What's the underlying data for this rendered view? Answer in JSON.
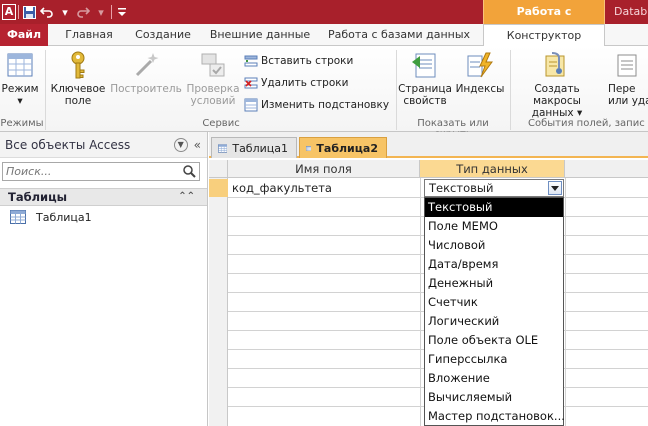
{
  "titlebar": {
    "app_icon_letter": "A",
    "context_tab_header": "Работа с таблицами",
    "title_text": "Datab"
  },
  "tabs": {
    "file": "Файл",
    "home": "Главная",
    "create": "Создание",
    "external": "Внешние данные",
    "dbtools": "Работа с базами данных",
    "design": "Конструктор"
  },
  "ribbon": {
    "view": {
      "label1": "Режим",
      "label2": "▾"
    },
    "primary_key": {
      "label1": "Ключевое",
      "label2": "поле"
    },
    "builder": {
      "label1": "Построитель"
    },
    "test_rules": {
      "label1": "Проверка",
      "label2": "условий"
    },
    "insert_rows": "Вставить строки",
    "delete_rows": "Удалить строки",
    "modify_lookups": "Изменить подстановку",
    "property_sheet": {
      "label1": "Страница",
      "label2": "свойств"
    },
    "indexes": {
      "label1": "Индексы"
    },
    "create_macros": {
      "label1": "Создать макросы",
      "label2": "данных ▾"
    },
    "rename": {
      "label1": "Пере",
      "label2": "или уда"
    },
    "groups": {
      "views": "Режимы",
      "tools": "Сервис",
      "show_hide": "Показать или скрыть",
      "events": "События полей, запис"
    }
  },
  "nav": {
    "header": "Все объекты Access",
    "search_placeholder": "Поиск...",
    "group": "Таблицы",
    "items": [
      "Таблица1"
    ]
  },
  "doc": {
    "tabs": [
      "Таблица1",
      "Таблица2"
    ],
    "columns": {
      "field_name": "Имя поля",
      "data_type": "Тип данных"
    },
    "rows": [
      {
        "field_name": "код_факультета",
        "data_type": "Текстовый"
      }
    ]
  },
  "dropdown": {
    "selected": "Текстовый",
    "options": [
      "Текстовый",
      "Поле MEMO",
      "Числовой",
      "Дата/время",
      "Денежный",
      "Счетчик",
      "Логический",
      "Поле объекта OLE",
      "Гиперссылка",
      "Вложение",
      "Вычисляемый",
      "Мастер подстановок..."
    ]
  },
  "colors": {
    "titlebar": "#a8202b",
    "file_tab": "#b62331",
    "context_tab": "#f2a33a",
    "active_doc_tab": "#f7c466",
    "type_header": "#fbd992"
  }
}
